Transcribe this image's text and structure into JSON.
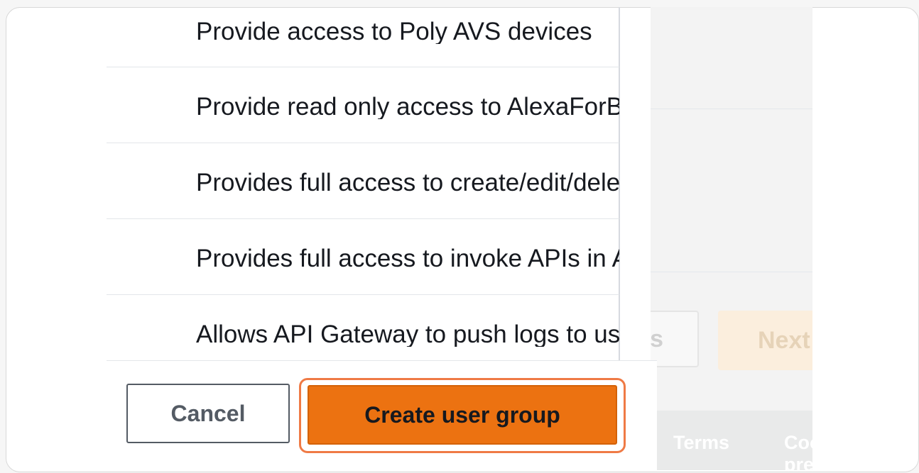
{
  "policies": [
    {
      "description": "Provide access to Poly AVS devices"
    },
    {
      "description": "Provide read only access to AlexaForBusiness"
    },
    {
      "description": "Provides full access to create/edit/delete"
    },
    {
      "description": "Provides full access to invoke APIs in Amazon API Gateway."
    },
    {
      "description": "Allows API Gateway to push logs to user's account."
    }
  ],
  "modal_footer": {
    "cancel_label": "Cancel",
    "create_label": "Create user group"
  },
  "background_page": {
    "previous_label": "Previous",
    "next_label": "Next",
    "footer_links": [
      "Terms",
      "Cookie preferences"
    ]
  },
  "colors": {
    "primary_button": "#ec7211",
    "highlight_outline": "#ef7a45",
    "cancel_border": "#545b64"
  }
}
